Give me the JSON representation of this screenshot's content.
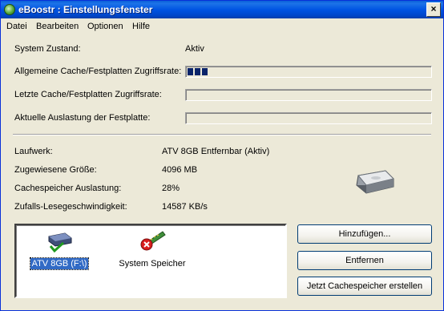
{
  "window": {
    "title": "eBoostr : Einstellungsfenster",
    "close_glyph": "×"
  },
  "menu": [
    "Datei",
    "Bearbeiten",
    "Optionen",
    "Hilfe"
  ],
  "status": {
    "system_label": "System Zustand:",
    "system_value": "Aktiv",
    "general_rate_label": "Allgemeine Cache/Festplatten Zugriffsrate:",
    "general_rate_progress": 0.1,
    "last_rate_label": "Letzte Cache/Festplatten Zugriffsrate:",
    "last_rate_progress": 0,
    "disk_load_label": "Aktuelle Auslastung der Festplatte:",
    "disk_load_progress": 0
  },
  "info": {
    "drive_label": "Laufwerk:",
    "drive_value": "ATV 8GB Entfernbar (Aktiv)",
    "size_label": "Zugewiesene Größe:",
    "size_value": "4096 MB",
    "usage_label": "Cachespeicher Auslastung:",
    "usage_value": "28%",
    "speed_label": "Zufalls-Lesegeschwindigkeit:",
    "speed_value": "14587 KB/s"
  },
  "devices": [
    {
      "label": "ATV 8GB (F:\\)",
      "icon": "usb-drive-check-icon",
      "selected": true
    },
    {
      "label": "System Speicher",
      "icon": "memory-error-icon",
      "selected": false
    }
  ],
  "buttons": {
    "add": "Hinzufügen...",
    "remove": "Entfernen",
    "create": "Jetzt Cachespeicher erstellen"
  },
  "colors": {
    "title_bar": "#0054e3",
    "window_bg": "#ece9d8",
    "progress_fill": "#0a246a",
    "selection": "#316ac5"
  }
}
